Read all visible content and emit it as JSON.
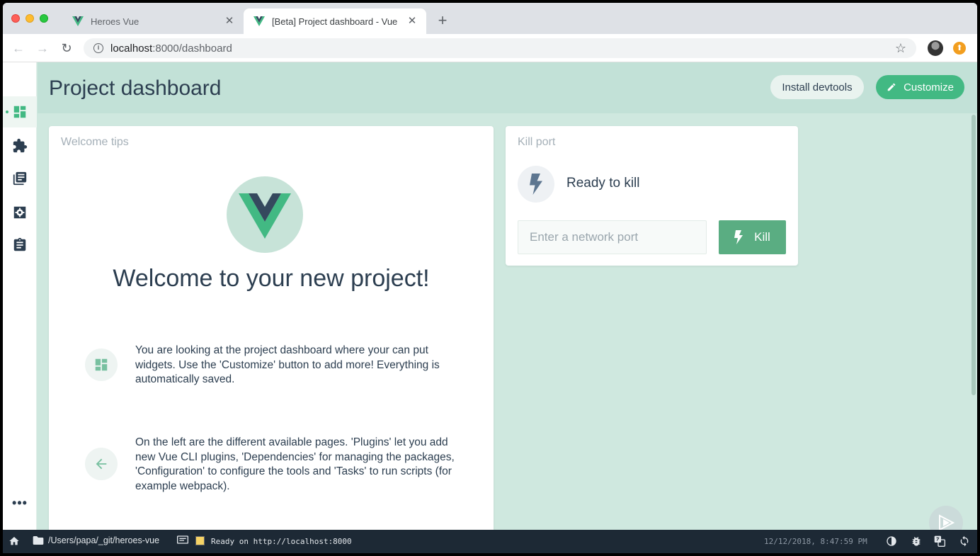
{
  "browser": {
    "tabs": [
      {
        "title": "Heroes Vue",
        "active": false
      },
      {
        "title": "[Beta] Project dashboard - Vue",
        "active": true
      }
    ],
    "url_host": "localhost",
    "url_rest": ":8000/dashboard"
  },
  "sidebar": {
    "items": [
      {
        "name": "dashboard",
        "icon": "dashboard-icon",
        "active": true
      },
      {
        "name": "plugins",
        "icon": "puzzle-icon",
        "active": false
      },
      {
        "name": "dependencies",
        "icon": "library-icon",
        "active": false
      },
      {
        "name": "configuration",
        "icon": "settings-box-icon",
        "active": false
      },
      {
        "name": "tasks",
        "icon": "clipboard-icon",
        "active": false
      }
    ],
    "more_label": "•••"
  },
  "header": {
    "title": "Project dashboard",
    "install_label": "Install devtools",
    "customize_label": "Customize"
  },
  "welcome": {
    "title": "Welcome tips",
    "heading": "Welcome to your new project!",
    "tips": [
      {
        "icon": "dashboard-icon",
        "text": "You are looking at the project dashboard where your can put widgets. Use the 'Customize' button to add more! Everything is automatically saved."
      },
      {
        "icon": "arrow-left-icon",
        "text": "On the left are the different available pages. 'Plugins' let you add new Vue CLI plugins, 'Dependencies' for managing the packages, 'Configuration' to configure the tools and 'Tasks' to run scripts (for example webpack)."
      }
    ]
  },
  "kill_port": {
    "title": "Kill port",
    "status": "Ready to kill",
    "input_placeholder": "Enter a network port",
    "button_label": "Kill"
  },
  "statusbar": {
    "path": "/Users/papa/_git/heroes-vue",
    "log": "Ready on http://localhost:8000",
    "timestamp": "12/12/2018, 8:47:59 PM"
  },
  "colors": {
    "accent": "#42b983",
    "dark": "#2c3e50",
    "background": "#cfe8df",
    "statusbar": "#1d2935"
  }
}
